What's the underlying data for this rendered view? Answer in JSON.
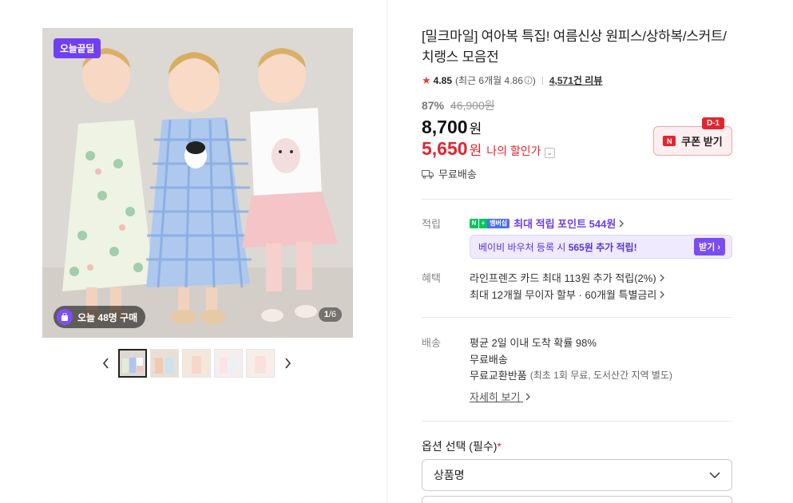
{
  "gallery": {
    "badge": "오늘끝딜",
    "buy_count": "오늘 48명 구매",
    "counter_current": "1",
    "counter_total": "/6",
    "thumbnails": [
      "thumb-1",
      "thumb-2",
      "thumb-3",
      "thumb-4",
      "thumb-5"
    ]
  },
  "product": {
    "title": "[밀크마일] 여아복 특집! 여름신상 원피스/상하복/스커트/치랭스 모음전",
    "rating": "4.85",
    "rating_recent": "(최근 6개월 4.86",
    "rating_info_icon": "info-icon",
    "rating_close": ")",
    "reviews": "4,571건 리뷰",
    "discount_pct": "87%",
    "original_price": "46,900원",
    "price": "8,700",
    "price_unit": "원",
    "my_price": "5,650",
    "my_price_unit": "원",
    "my_price_label": "나의 할인가",
    "coupon_label": "쿠폰 받기",
    "coupon_n": "N",
    "coupon_dday": "D-1",
    "shipping": "무료배송"
  },
  "benefits": {
    "point_label": "적립",
    "npay_n": "N",
    "npay_plus": "+",
    "npay_member": "멤버십",
    "point_text": "최대 적립 포인트 544원",
    "voucher_pre": "베이비 바우처 등록 시 ",
    "voucher_bold": "565원 추가 적립!",
    "voucher_btn": "받기",
    "benefit_label": "혜택",
    "card_line": "라인프렌즈 카드 최대 113원 추가 적립(2%)",
    "installment_line": "최대 12개월 무이자 할부 · 60개월 특별금리"
  },
  "delivery": {
    "label": "배송",
    "line1": "평균 2일 이내 도착 확률 98%",
    "line2": "무료배송",
    "line3": "무료교환반품",
    "line3_small": "(최초 1회 무료, 도서산간 지역 별도)",
    "detail_link": "자세히 보기"
  },
  "options": {
    "label": "옵션 선택 (필수)",
    "required_mark": "*",
    "select_value": "상품명"
  },
  "colors": {
    "accent_red": "#e4252e",
    "accent_purple": "#6b3ef2",
    "npay_green": "#03c75a"
  }
}
